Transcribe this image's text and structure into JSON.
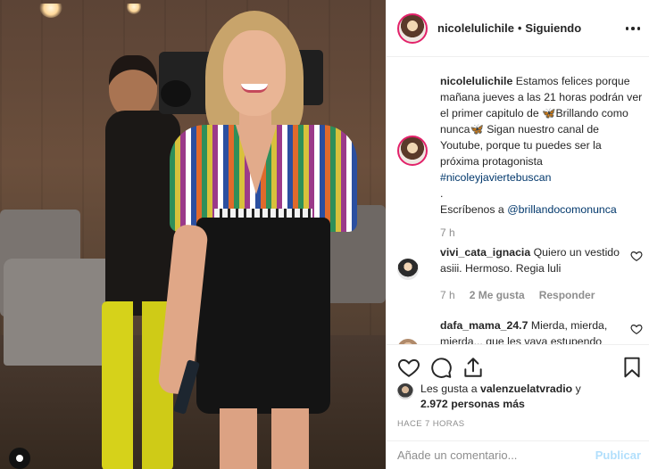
{
  "post": {
    "username": "nicolelulichile",
    "follow_status": "Siguiendo",
    "separator": "•"
  },
  "caption": {
    "username": "nicolelulichile",
    "text_part1": " Estamos felices porque mañana jueves a las 21 horas podrán ver el primer capitulo de 🦋Brillando como nunca🦋 Sigan nuestro canal de Youtube, porque tu puedes ser la próxima protagonista ",
    "hashtag": "#nicoleyjaviertebuscan",
    "dot_line": ".",
    "text_part2": "Escríbenos a ",
    "mention": "@brillandocomonunca",
    "time": "7 h"
  },
  "comments": [
    {
      "username": "vivi_cata_ignacia",
      "text": " Quiero un vestido asiii. Hermoso. Regia luli",
      "time": "7 h",
      "likes": "2 Me gusta",
      "reply": "Responder"
    },
    {
      "username": "dafa_mama_24.7",
      "text": " Mierda, mierda, mierda... que les vaya estupendo"
    }
  ],
  "likes": {
    "prefix": "Les gusta a ",
    "user": "valenzuelatvradio",
    "connector": " y",
    "count": "2.972 personas más"
  },
  "time_ago": "HACE 7 HORAS",
  "add_comment": {
    "placeholder": "Añade un comentario...",
    "publish_label": "Publicar"
  },
  "icons": {
    "like": "heart-icon",
    "comment": "comment-icon",
    "share": "share-icon",
    "save": "bookmark-icon",
    "more": "more-options-icon",
    "tag": "user-tag-icon"
  },
  "colors": {
    "link": "#00376b",
    "muted": "#8e8e8e",
    "publish_disabled": "#b2dffc",
    "story_ring": "#e2226a"
  }
}
